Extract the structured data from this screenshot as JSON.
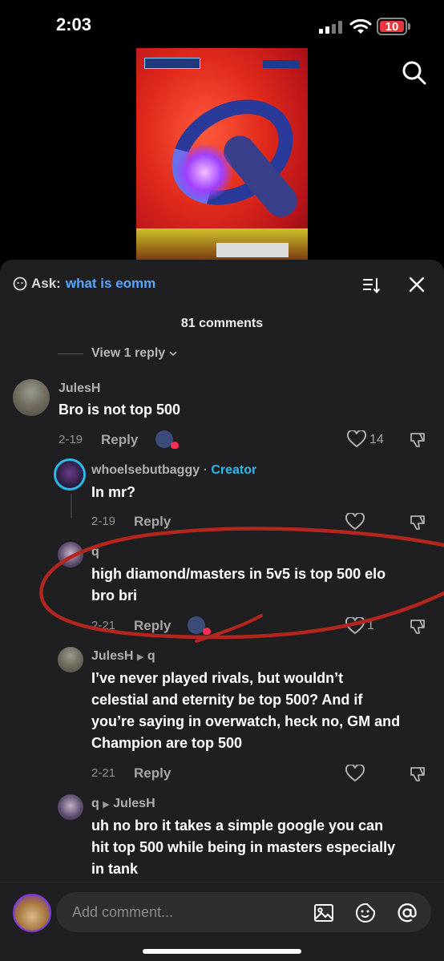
{
  "status_bar": {
    "time": "2:03",
    "battery": "10",
    "battery_color": "#e8373b"
  },
  "header": {
    "ask_label": "Ask:",
    "ask_query": "what is eomm",
    "comment_count": "81 comments",
    "ask_query_color": "#58a7ff"
  },
  "thread": {
    "view_reply_label": "View 1 reply"
  },
  "comments": [
    {
      "author": "JulesH",
      "text": "Bro is not top 500",
      "date": "2-19",
      "reply_label": "Reply",
      "likes": "14"
    },
    {
      "author": "whoelsebutbaggy",
      "badge": "Creator",
      "text": "In mr?",
      "date": "2-19",
      "reply_label": "Reply"
    },
    {
      "author": "q",
      "text_lines": [
        "high diamond/masters in 5v5 is top 500 elo",
        "bro bri"
      ],
      "date": "2-21",
      "reply_label": "Reply",
      "likes": "1"
    },
    {
      "author": "JulesH",
      "reply_to": "q",
      "text_lines": [
        "I’ve never played rivals, but wouldn’t",
        "celestial and eternity be top 500? And if",
        "you’re saying in overwatch, heck no, GM and",
        "Champion are top 500"
      ],
      "date": "2-21",
      "reply_label": "Reply"
    },
    {
      "author": "q",
      "reply_to": "JulesH",
      "text_lines": [
        "uh no bro it takes a simple google you can",
        "hit top 500 while being in masters especially",
        "in tank"
      ]
    }
  ],
  "composer": {
    "placeholder": "Add comment...",
    "icons": [
      "image-icon",
      "sticker-icon",
      "mention-icon"
    ]
  },
  "colors": {
    "panel_bg": "#1f1f21",
    "creator_badge": "#2ab9e8",
    "annotation_red": "#b3261e"
  }
}
